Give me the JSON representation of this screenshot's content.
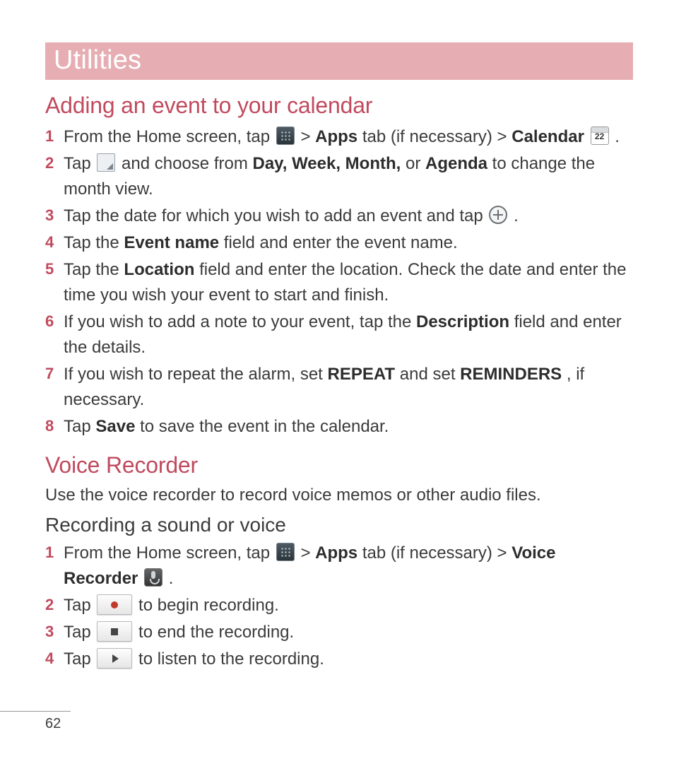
{
  "title": "Utilities",
  "section1": {
    "heading": "Adding an event to your calendar",
    "steps": [
      {
        "pre": "From the Home screen, tap ",
        "icon1": "apps",
        "mid1": " > ",
        "b1": "Apps",
        "mid2": " tab (if necessary) > ",
        "b2": "Calendar",
        "icon2": "calendar",
        "post": "."
      },
      {
        "pre": "Tap ",
        "icon1": "dropdown",
        "mid1": " and choose from ",
        "b1": "Day, Week, Month,",
        "mid2": " or ",
        "b2": "Agenda",
        "post": " to change the month view."
      },
      {
        "pre": "Tap the date for which you wish to add an event and tap ",
        "icon1": "plus",
        "post": "."
      },
      {
        "pre": "Tap the ",
        "b1": "Event name",
        "post": " field and enter the event name."
      },
      {
        "pre": "Tap the ",
        "b1": "Location",
        "post": " field and enter the location. Check the date and enter the time you wish your event to start and finish."
      },
      {
        "pre": "If you wish to add a note to your event, tap the ",
        "b1": "Description",
        "post": " field and enter the details."
      },
      {
        "pre": "If you wish to repeat the alarm, set ",
        "b1": "REPEAT",
        "mid1": " and set ",
        "b2": "REMINDERS",
        "post": ", if necessary."
      },
      {
        "pre": "Tap ",
        "b1": "Save",
        "post": " to save the event in the calendar."
      }
    ]
  },
  "section2": {
    "heading": "Voice Recorder",
    "intro": "Use the voice recorder to record voice memos or other audio files.",
    "sub": "Recording a sound or voice",
    "steps": [
      {
        "pre": "From the Home screen, tap ",
        "icon1": "apps",
        "mid1": " > ",
        "b1": "Apps",
        "mid2": " tab (if necessary) > ",
        "b2": "Voice Recorder",
        "icon2": "recorder",
        "post": "."
      },
      {
        "pre": "Tap ",
        "btn": "rec",
        "post": " to begin recording."
      },
      {
        "pre": "Tap ",
        "btn": "stop",
        "post": " to end the recording."
      },
      {
        "pre": "Tap ",
        "btn": "play",
        "post": " to listen to the recording."
      }
    ]
  },
  "calendar_day": "22",
  "page_number": "62"
}
